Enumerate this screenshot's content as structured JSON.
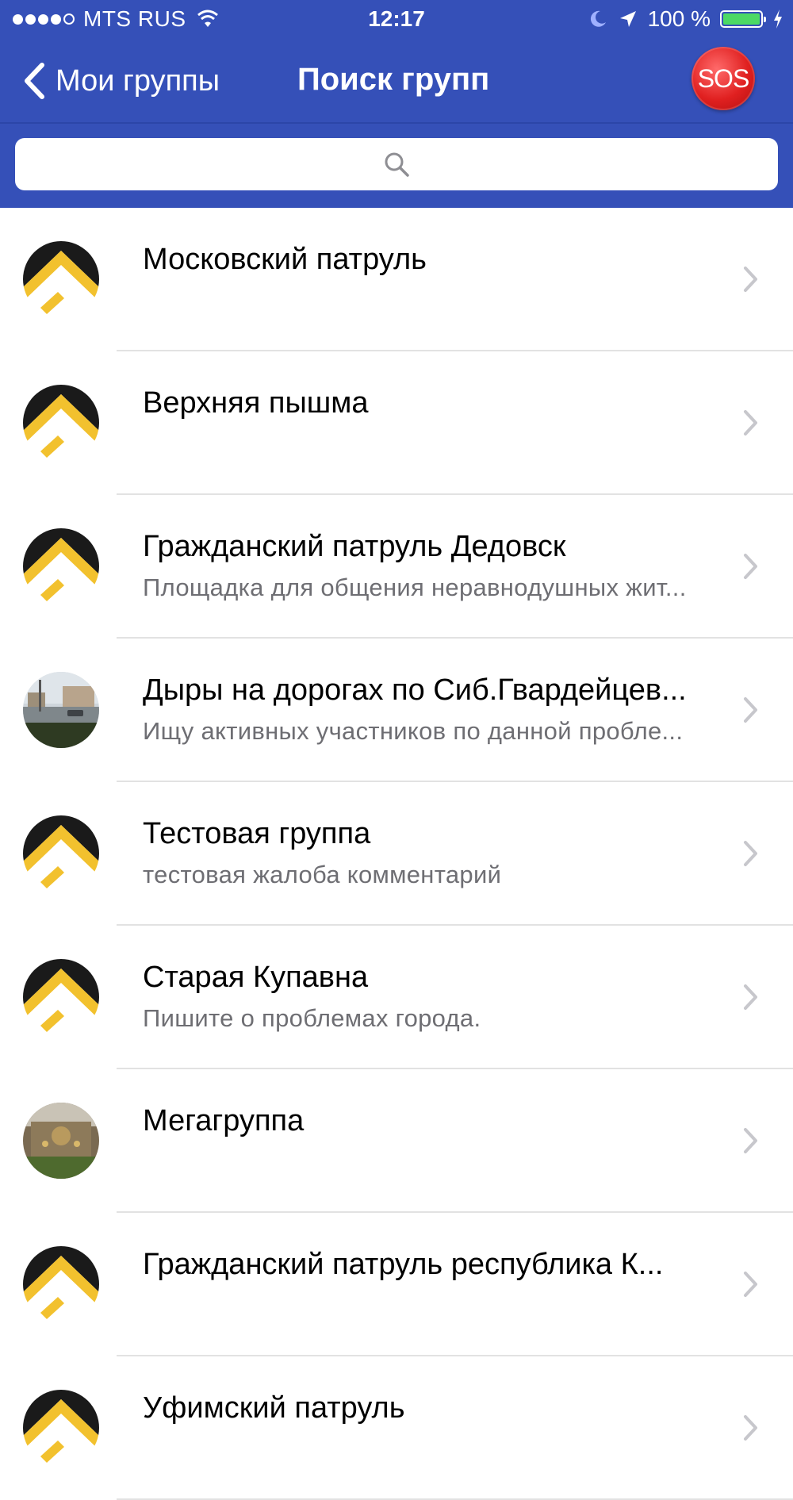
{
  "status_bar": {
    "carrier": "MTS RUS",
    "time": "12:17",
    "battery": "100 %"
  },
  "nav": {
    "back_label": "Мои группы",
    "title": "Поиск групп",
    "sos_label": "SOS"
  },
  "search": {
    "placeholder": ""
  },
  "groups": [
    {
      "title": "Московский патруль",
      "subtitle": "",
      "avatar": "patrol-logo"
    },
    {
      "title": "Верхняя пышма",
      "subtitle": "",
      "avatar": "patrol-logo"
    },
    {
      "title": "Гражданский патруль Дедовск",
      "subtitle": "Площадка для общения неравнодушных жит...",
      "avatar": "patrol-logo"
    },
    {
      "title": "Дыры на дорогах по Сиб.Гвардейцев...",
      "subtitle": "Ищу активных участников по данной пробле...",
      "avatar": "road-photo"
    },
    {
      "title": "Тестовая группа",
      "subtitle": "тестовая жалоба комментарий",
      "avatar": "patrol-logo"
    },
    {
      "title": "Старая Купавна",
      "subtitle": "Пишите о проблемах города.",
      "avatar": "patrol-logo"
    },
    {
      "title": "Мегагруппа",
      "subtitle": "",
      "avatar": "building-photo"
    },
    {
      "title": "Гражданский патруль республика К...",
      "subtitle": "",
      "avatar": "patrol-logo"
    },
    {
      "title": "Уфимский патруль",
      "subtitle": "",
      "avatar": "patrol-logo"
    }
  ]
}
